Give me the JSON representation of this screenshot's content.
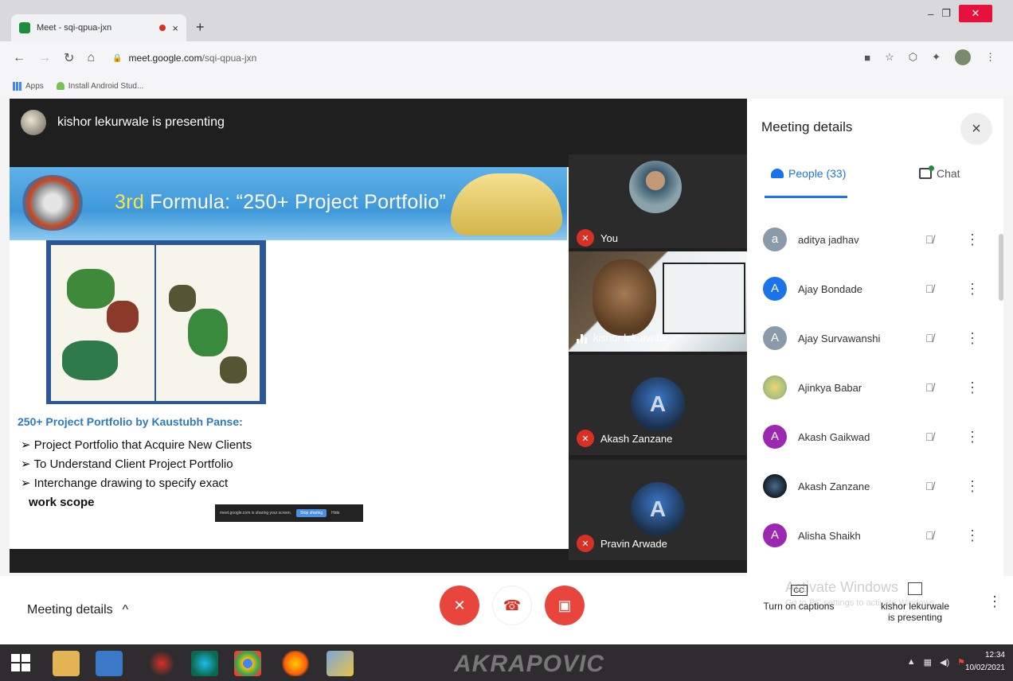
{
  "browser": {
    "tab_title": "Meet - sqi-qpua-jxn",
    "tab_close": "×",
    "new_tab": "+",
    "url_host": "meet.google.com",
    "url_path": "/sqi-qpua-jxn",
    "window_controls": {
      "minimize": "–",
      "maximize": "❐",
      "close": "✕"
    },
    "bookmarks": [
      "Apps",
      "Install Android Stud..."
    ]
  },
  "stage": {
    "presenting_label": "kishor lekurwale is presenting"
  },
  "slide": {
    "title_ordinal": "3rd",
    "title_rest": " Formula: “250+ Project Portfolio”",
    "subtitle": "250+ Project Portfolio by Kaustubh Panse:",
    "bullets": [
      "➢ Project Portfolio that Acquire New Clients",
      "➢ To Understand Client Project Portfolio",
      "➢ Interchange drawing to specify exact",
      "work scope"
    ],
    "share_notice": "meet.google.com is sharing your screen.",
    "share_stop": "Stop sharing",
    "share_hide": "Hide"
  },
  "tiles": [
    {
      "name": "You",
      "muted": true
    },
    {
      "name": "kishor lekurwale",
      "muted": false
    },
    {
      "name": "Akash Zanzane",
      "muted": true
    },
    {
      "name": "Pravin Arwade",
      "muted": true
    }
  ],
  "panel": {
    "title": "Meeting details",
    "close": "×",
    "people_tab": "People (33)",
    "chat_tab": "Chat",
    "participants": [
      {
        "name": "aditya jadhav",
        "initial": "a",
        "color": "#8a9aa9"
      },
      {
        "name": "Ajay Bondade",
        "initial": "A",
        "color": "#1a73e8"
      },
      {
        "name": "Ajay Survawanshi",
        "initial": "A",
        "color": "#8a9aa9"
      },
      {
        "name": "Ajinkya Babar",
        "initial": "",
        "color": "#a6c47a"
      },
      {
        "name": "Akash Gaikwad",
        "initial": "A",
        "color": "#9c27b0"
      },
      {
        "name": "Akash Zanzane",
        "initial": "",
        "color": "#263445"
      },
      {
        "name": "Alisha Shaikh",
        "initial": "A",
        "color": "#9c27b0"
      }
    ]
  },
  "bottom": {
    "meeting_details": "Meeting details",
    "captions": "Turn on captions",
    "cc": "CC",
    "activate_title": "Activate Windows",
    "activate_sub": "Go to PC settings to activate Windows.",
    "presenting_line1": "kishor lekurwale",
    "presenting_line2": "is presenting"
  },
  "taskbar": {
    "brand": "AKRAPOVIC",
    "time": "12:34",
    "date": "10/02/2021"
  }
}
